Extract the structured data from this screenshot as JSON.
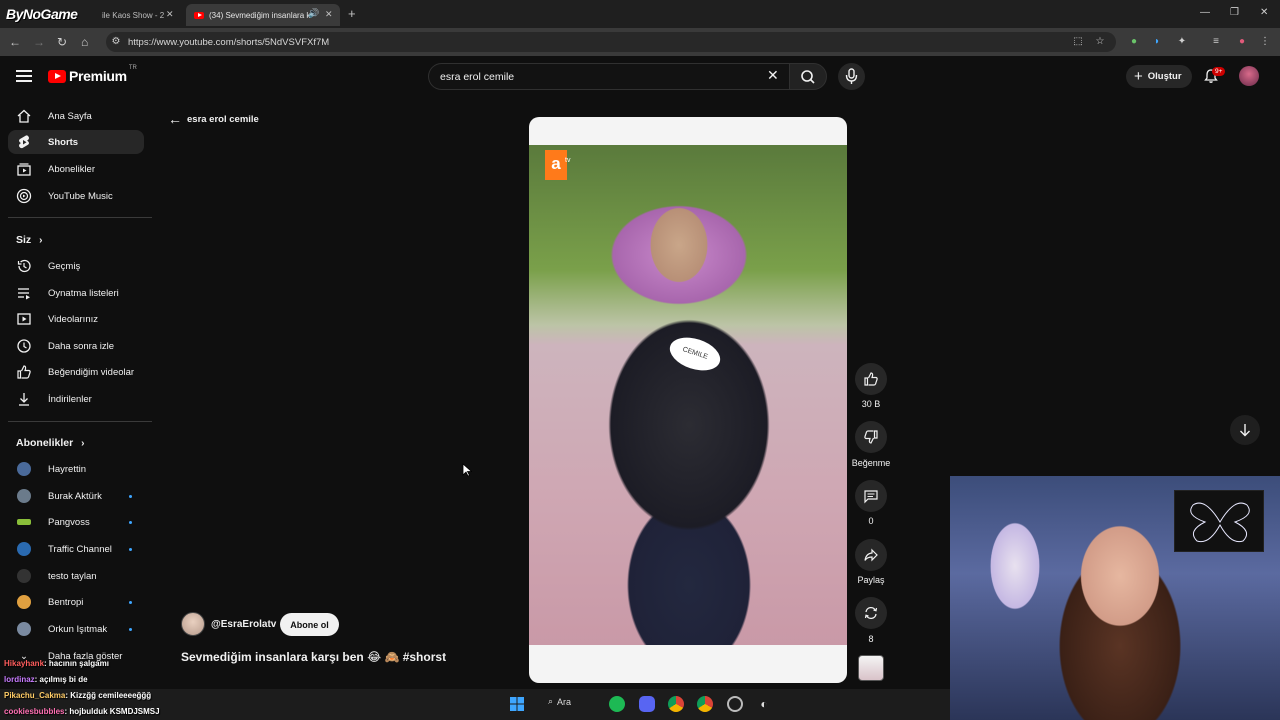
{
  "browser": {
    "overlay_logo": "ByNoGame",
    "tabs": [
      {
        "title": "ile Kaos Show - 2",
        "active": false
      },
      {
        "title": "(34) Sevmediğim insanlara k",
        "active": true
      }
    ],
    "new_tab": "+",
    "url": "https://www.youtube.com/shorts/5NdVSVFXf7M",
    "window_controls": [
      "minimize",
      "restore",
      "close"
    ]
  },
  "masthead": {
    "logo": "Premium",
    "region": "TR",
    "search_value": "esra erol cemile",
    "create_label": "Oluştur",
    "notif_badge": "9+"
  },
  "sidebar": {
    "main": [
      {
        "label": "Ana Sayfa",
        "icon": "home-icon"
      },
      {
        "label": "Shorts",
        "icon": "shorts-icon",
        "active": true
      },
      {
        "label": "Abonelikler",
        "icon": "subscriptions-icon"
      },
      {
        "label": "YouTube Music",
        "icon": "music-icon"
      }
    ],
    "you_heading": "Siz",
    "you": [
      {
        "label": "Geçmiş",
        "icon": "history-icon"
      },
      {
        "label": "Oynatma listeleri",
        "icon": "playlists-icon"
      },
      {
        "label": "Videolarınız",
        "icon": "your-videos-icon"
      },
      {
        "label": "Daha sonra izle",
        "icon": "watch-later-icon"
      },
      {
        "label": "Beğendiğim videolar",
        "icon": "liked-icon"
      },
      {
        "label": "İndirilenler",
        "icon": "download-icon"
      }
    ],
    "subs_heading": "Abonelikler",
    "subs": [
      {
        "label": "Hayrettin",
        "color": "#4a6a9a",
        "new": false
      },
      {
        "label": "Burak Aktürk",
        "color": "#6b7b8b",
        "new": true
      },
      {
        "label": "Pangvoss",
        "color": "#8abf3a",
        "new": true
      },
      {
        "label": "Traffic Channel",
        "color": "#2a6ab0",
        "new": true
      },
      {
        "label": "testo taylan",
        "color": "#333333",
        "new": false
      },
      {
        "label": "Bentropi",
        "color": "#e0a040",
        "new": true
      },
      {
        "label": "Orkun Işıtmak",
        "color": "#7a8aa0",
        "new": true
      }
    ],
    "show_more": "Daha fazla göster"
  },
  "shorts": {
    "back_label": "esra erol cemile",
    "channel": "@EsraErolatv",
    "subscribe_label": "Abone ol",
    "title": "Sevmediğim insanlara karşı ben 😂 🙈 #shorst",
    "actions": [
      {
        "label": "30 B",
        "icon": "like-icon"
      },
      {
        "label": "Beğenme",
        "icon": "dislike-icon"
      },
      {
        "label": "0",
        "icon": "comment-icon"
      },
      {
        "label": "Paylaş",
        "icon": "share-icon"
      },
      {
        "label": "8",
        "icon": "remix-icon"
      }
    ],
    "video_badge": "atv",
    "name_tag": "CEMILE"
  },
  "chat": [
    {
      "user": "Hikayhank",
      "msg": ": hacının şalgamı"
    },
    {
      "user": "lordinaz",
      "msg": ": açılmış bi de"
    },
    {
      "user": "Pikachu_Cakma",
      "msg": ": Kizzğğ cemileeeeğğğ"
    },
    {
      "user": "cookiesbubbles",
      "msg": ": hojbulduk KSMDJSMSJ"
    }
  ],
  "taskbar": {
    "search_label": "Ara",
    "apps": [
      "windows-icon",
      "spotify-icon",
      "discord-icon",
      "chrome-icon",
      "chrome-icon",
      "app-icon",
      "app-icon"
    ]
  }
}
